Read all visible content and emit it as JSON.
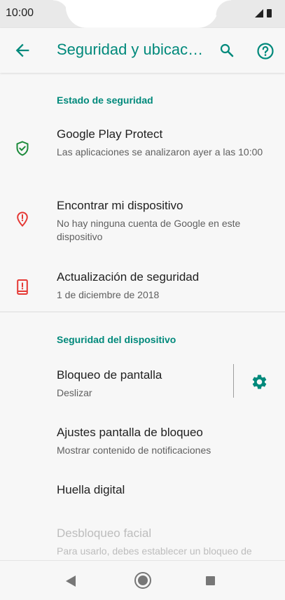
{
  "status": {
    "time": "10:00"
  },
  "appbar": {
    "title": "Seguridad y ubicación"
  },
  "sections": {
    "security_status": "Estado de seguridad",
    "device_security": "Seguridad del dispositivo"
  },
  "items": {
    "play_protect": {
      "title": "Google Play Protect",
      "subtitle": "Las aplicaciones se analizaron ayer a las 10:00"
    },
    "find_device": {
      "title": "Encontrar mi dispositivo",
      "subtitle": "No hay ninguna cuenta de Google en este dispositivo"
    },
    "security_update": {
      "title": "Actualización de seguridad",
      "subtitle": "1 de diciembre de 2018"
    },
    "screen_lock": {
      "title": "Bloqueo de pantalla",
      "subtitle": "Deslizar"
    },
    "lock_screen_settings": {
      "title": "Ajustes pantalla de bloqueo",
      "subtitle": "Mostrar contenido de notificaciones"
    },
    "fingerprint": {
      "title": "Huella digital"
    },
    "face_unlock": {
      "title": "Desbloqueo facial",
      "subtitle": "Para usarlo, debes establecer un bloqueo de pantalla"
    }
  },
  "colors": {
    "accent": "#00897b",
    "shield": "#1b8a3a",
    "warning": "#e53935"
  },
  "icons": {
    "back": "arrow-back-icon",
    "search": "search-icon",
    "help": "help-icon",
    "play_protect": "shield-check-icon",
    "find_device": "location-alert-icon",
    "security_update": "phone-alert-icon",
    "screen_lock_settings": "gear-icon",
    "nav_back": "triangle-back-icon",
    "nav_home": "circle-home-icon",
    "nav_recent": "square-recent-icon"
  }
}
